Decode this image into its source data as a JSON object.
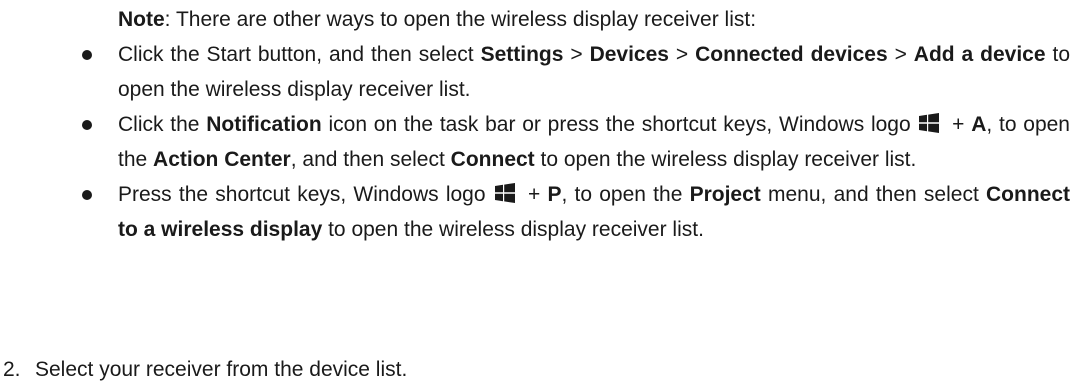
{
  "note": {
    "label": "Note",
    "text": ": There are other ways to open the wireless display receiver list:"
  },
  "bullets": [
    {
      "t1": "Click the Start button, and then select ",
      "b1": "Settings",
      "t2": " > ",
      "b2": "Devices",
      "t3": " > ",
      "b3": "Connected devices",
      "t4": " > ",
      "b4": "Add a device",
      "t5": " to open the wireless display receiver list."
    },
    {
      "t1": "Click the ",
      "b1": "Notification",
      "t2": " icon on the task bar or press the shortcut keys, Windows logo ",
      "t3": " + ",
      "b2": "A",
      "t4": ", to open the ",
      "b3": "Action Center",
      "t5": ", and then select ",
      "b4": "Connect",
      "t6": " to open the wireless display receiver list."
    },
    {
      "t1": "Press the shortcut keys, Windows logo ",
      "t2": " + ",
      "b1": "P",
      "t3": ", to open the ",
      "b2": "Project",
      "t4": " menu, and then select ",
      "b3": "Connect to a wireless display",
      "t5": " to open the wireless display receiver list."
    }
  ],
  "step": {
    "number": "2.",
    "text": "Select your receiver from the device list."
  },
  "icons": {
    "windows_logo": "windows-logo-icon",
    "bullet": "bullet-dot-icon"
  }
}
